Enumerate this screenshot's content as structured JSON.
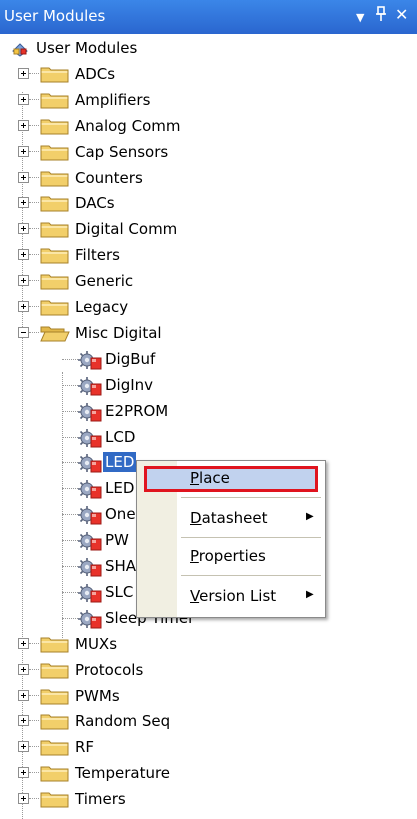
{
  "title_bar": {
    "title": "User Modules",
    "dropdown_glyph": "▼",
    "pin_glyph": "ᵖ",
    "close_glyph": "✕"
  },
  "tree": {
    "root": {
      "label": "User Modules",
      "icon": "user-modules-icon"
    },
    "folders_before": [
      {
        "label": "ADCs"
      },
      {
        "label": "Amplifiers"
      },
      {
        "label": "Analog Comm"
      },
      {
        "label": "Cap Sensors"
      },
      {
        "label": "Counters"
      },
      {
        "label": "DACs"
      },
      {
        "label": "Digital Comm"
      },
      {
        "label": "Filters"
      },
      {
        "label": "Generic"
      },
      {
        "label": "Legacy"
      }
    ],
    "expanded_folder": {
      "label": "Misc Digital",
      "children": [
        {
          "label": "DigBuf"
        },
        {
          "label": "DigInv"
        },
        {
          "label": "E2PROM"
        },
        {
          "label": "LCD"
        },
        {
          "label": "LED",
          "selected": true
        },
        {
          "label": "LED"
        },
        {
          "label": "One"
        },
        {
          "label": "PW"
        },
        {
          "label": "SHA"
        },
        {
          "label": "SLC"
        },
        {
          "label": "Sleep Timer"
        }
      ]
    },
    "folders_after": [
      {
        "label": "MUXs"
      },
      {
        "label": "Protocols"
      },
      {
        "label": "PWMs"
      },
      {
        "label": "Random Seq"
      },
      {
        "label": "RF"
      },
      {
        "label": "Temperature"
      },
      {
        "label": "Timers"
      }
    ]
  },
  "context_menu": {
    "items": [
      {
        "label": "Place",
        "mnemonic": "P",
        "rest": "lace",
        "highlighted": true,
        "submenu": false
      },
      {
        "label": "Datasheet",
        "mnemonic": "D",
        "rest": "atasheet",
        "submenu": true
      },
      {
        "label": "Properties",
        "mnemonic": "P",
        "rest": "roperties",
        "submenu": false
      },
      {
        "label": "Version List",
        "mnemonic": "V",
        "rest": "ersion List",
        "submenu": true
      }
    ],
    "submenu_arrow": "▶",
    "highlight_border_color": "#e0141e"
  },
  "colors": {
    "title_bar": "#2a66cf",
    "selection": "#316ac5",
    "menu_highlight": "#c1d2ee",
    "folder": "#f2cf6a"
  }
}
